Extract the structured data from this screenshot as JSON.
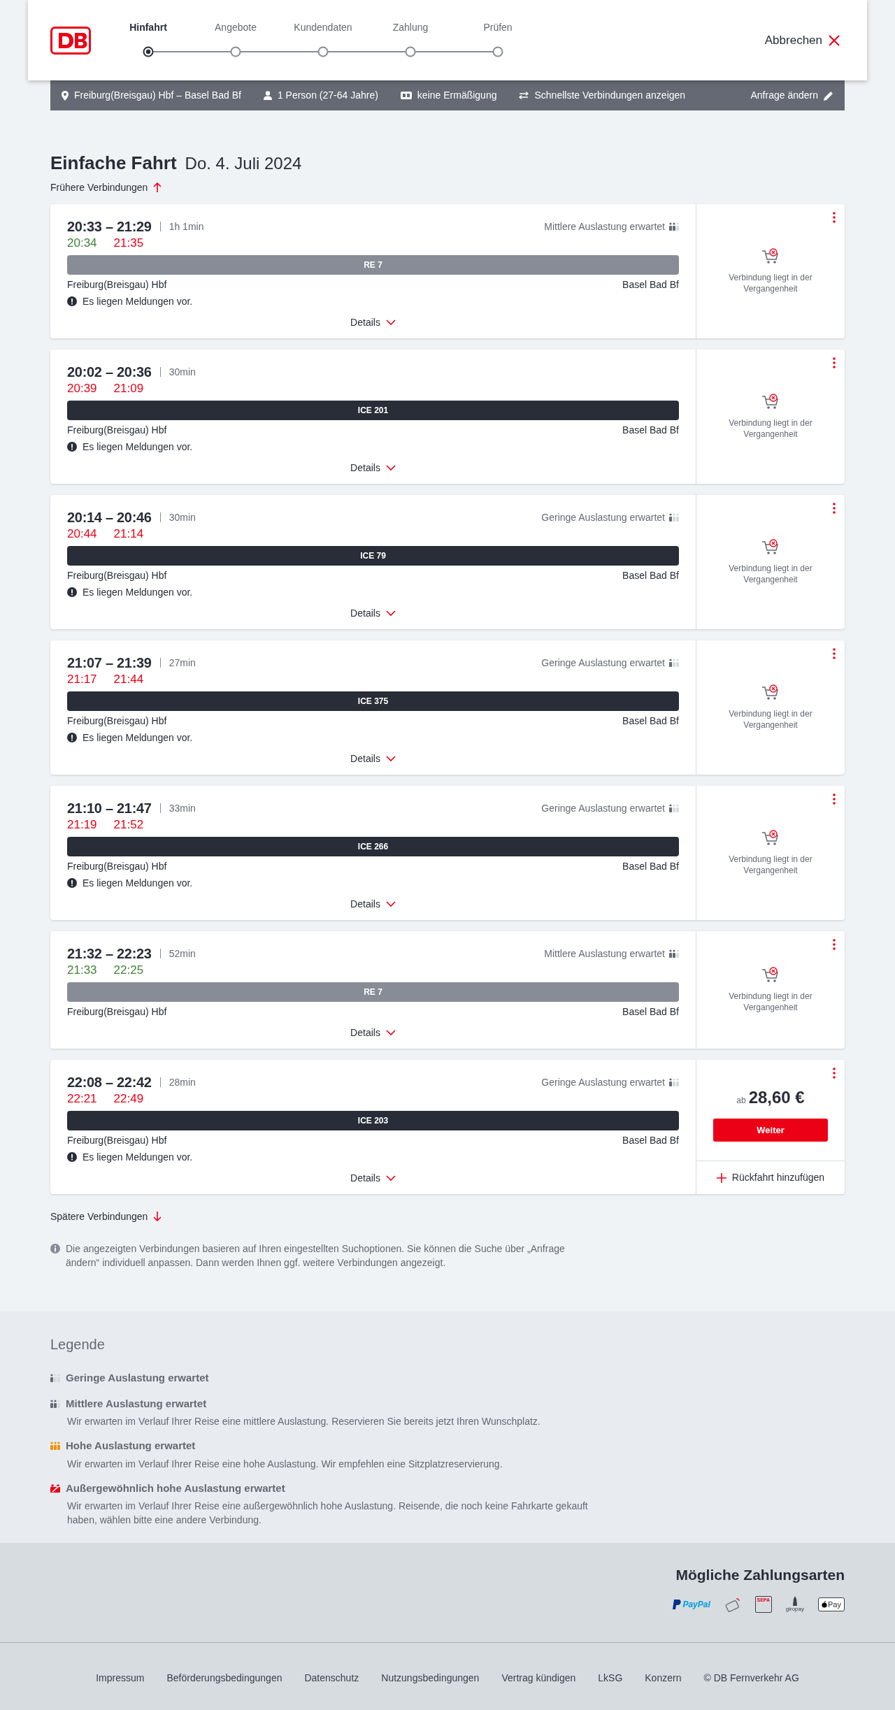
{
  "header": {
    "steps": [
      {
        "label": "Hinfahrt",
        "selected": true
      },
      {
        "label": "Angebote",
        "selected": false
      },
      {
        "label": "Kundendaten",
        "selected": false
      },
      {
        "label": "Zahlung",
        "selected": false
      },
      {
        "label": "Prüfen",
        "selected": false
      }
    ],
    "cancel": "Abbrechen"
  },
  "summary": {
    "items": [
      {
        "kind": "route",
        "text": "Freiburg(Breisgau) Hbf – Basel Bad Bf"
      },
      {
        "kind": "person",
        "text": "1 Person (27-64 Jahre)"
      },
      {
        "kind": "card",
        "text": "keine Ermäßigung"
      },
      {
        "kind": "option",
        "text": "Schnellste Verbindungen anzeigen"
      }
    ],
    "edit": "Anfrage ändern"
  },
  "title": "Einfache Fahrt",
  "date": "Do. 4. Juli 2024",
  "earlier": "Frühere Verbindungen",
  "connections": [
    {
      "times": "20:33 – 21:29",
      "duration": "1h 1min",
      "occupancy": {
        "kind": "medium",
        "text": "Mittlere Auslastung erwartet"
      },
      "actual": [
        {
          "time": "20:34",
          "delayed": false
        },
        {
          "time": "21:35",
          "delayed": true
        }
      ],
      "train": {
        "kind": "regional",
        "name": "RE 7"
      },
      "from": "Freiburg(Breisgau) Hbf",
      "to": "Basel Bad Bf",
      "notice": "Es liegen Meldungen vor.",
      "details": "Details",
      "offer": {
        "kind": "past",
        "text": "Verbindung liegt in der Vergangenheit"
      }
    },
    {
      "times": "20:02 – 20:36",
      "duration": "30min",
      "actual": [
        {
          "time": "20:39",
          "delayed": true
        },
        {
          "time": "21:09",
          "delayed": true
        }
      ],
      "train": {
        "kind": "ice",
        "name": "ICE 201"
      },
      "from": "Freiburg(Breisgau) Hbf",
      "to": "Basel Bad Bf",
      "notice": "Es liegen Meldungen vor.",
      "details": "Details",
      "offer": {
        "kind": "past",
        "text": "Verbindung liegt in der Vergangenheit"
      }
    },
    {
      "times": "20:14 – 20:46",
      "duration": "30min",
      "occupancy": {
        "kind": "low",
        "text": "Geringe Auslastung erwartet"
      },
      "actual": [
        {
          "time": "20:44",
          "delayed": true
        },
        {
          "time": "21:14",
          "delayed": true
        }
      ],
      "train": {
        "kind": "ice",
        "name": "ICE 79"
      },
      "from": "Freiburg(Breisgau) Hbf",
      "to": "Basel Bad Bf",
      "notice": "Es liegen Meldungen vor.",
      "details": "Details",
      "offer": {
        "kind": "past",
        "text": "Verbindung liegt in der Vergangenheit"
      }
    },
    {
      "times": "21:07 – 21:39",
      "duration": "27min",
      "occupancy": {
        "kind": "low",
        "text": "Geringe Auslastung erwartet"
      },
      "actual": [
        {
          "time": "21:17",
          "delayed": true
        },
        {
          "time": "21:44",
          "delayed": true
        }
      ],
      "train": {
        "kind": "ice",
        "name": "ICE 375"
      },
      "from": "Freiburg(Breisgau) Hbf",
      "to": "Basel Bad Bf",
      "notice": "Es liegen Meldungen vor.",
      "details": "Details",
      "offer": {
        "kind": "past",
        "text": "Verbindung liegt in der Vergangenheit"
      }
    },
    {
      "times": "21:10 – 21:47",
      "duration": "33min",
      "occupancy": {
        "kind": "low",
        "text": "Geringe Auslastung erwartet"
      },
      "actual": [
        {
          "time": "21:19",
          "delayed": true
        },
        {
          "time": "21:52",
          "delayed": true
        }
      ],
      "train": {
        "kind": "ice",
        "name": "ICE 266"
      },
      "from": "Freiburg(Breisgau) Hbf",
      "to": "Basel Bad Bf",
      "notice": "Es liegen Meldungen vor.",
      "details": "Details",
      "offer": {
        "kind": "past",
        "text": "Verbindung liegt in der Vergangenheit"
      }
    },
    {
      "times": "21:32 – 22:23",
      "duration": "52min",
      "occupancy": {
        "kind": "medium",
        "text": "Mittlere Auslastung erwartet"
      },
      "actual": [
        {
          "time": "21:33",
          "delayed": false
        },
        {
          "time": "22:25",
          "delayed": false
        }
      ],
      "train": {
        "kind": "regional",
        "name": "RE 7"
      },
      "from": "Freiburg(Breisgau) Hbf",
      "to": "Basel Bad Bf",
      "details": "Details",
      "offer": {
        "kind": "past",
        "text": "Verbindung liegt in der Vergangenheit"
      }
    },
    {
      "times": "22:08 – 22:42",
      "duration": "28min",
      "occupancy": {
        "kind": "low",
        "text": "Geringe Auslastung erwartet"
      },
      "actual": [
        {
          "time": "22:21",
          "delayed": true
        },
        {
          "time": "22:49",
          "delayed": true
        }
      ],
      "train": {
        "kind": "ice",
        "name": "ICE 203"
      },
      "from": "Freiburg(Breisgau) Hbf",
      "to": "Basel Bad Bf",
      "notice": "Es liegen Meldungen vor.",
      "details": "Details",
      "offer": {
        "kind": "price",
        "prefix": "ab",
        "price": "28,60 €",
        "button": "Weiter",
        "return": "Rückfahrt hinzufügen"
      }
    }
  ],
  "later": "Spätere Verbindungen",
  "info": "Die angezeigten Verbindungen basieren auf Ihren eingestellten Suchoptionen. Sie können die Suche über „Anfrage ändern“ individuell anpassen. Dann werden Ihnen ggf. weitere Verbindungen angezeigt.",
  "legend": {
    "title": "Legende",
    "items": [
      {
        "kind": "low",
        "title": "Geringe Auslastung erwartet"
      },
      {
        "kind": "medium",
        "title": "Mittlere Auslastung erwartet",
        "text": "Wir erwarten im Verlauf Ihrer Reise eine mittlere Auslastung. Reservieren Sie bereits jetzt Ihren Wunschplatz."
      },
      {
        "kind": "high",
        "title": "Hohe Auslastung erwartet",
        "text": "Wir erwarten im Verlauf Ihrer Reise eine hohe Auslastung. Wir empfehlen eine Sitzplatzreservierung."
      },
      {
        "kind": "exceptional",
        "title": "Außergewöhnlich hohe Auslastung erwartet",
        "text": "Wir erwarten im Verlauf Ihrer Reise eine außergewöhnlich hohe Auslastung. Reisende, die noch keine Fahrkarte gekauft haben, wählen bitte eine andere Verbindung."
      }
    ]
  },
  "payment": {
    "title": "Mögliche Zahlungsarten",
    "methods": [
      {
        "kind": "paypal",
        "label": "PayPal"
      },
      {
        "kind": "creditcard"
      },
      {
        "kind": "sepa",
        "label": "SEPA"
      },
      {
        "kind": "giropay",
        "label": "giropay"
      },
      {
        "kind": "applepay",
        "label": "Pay"
      }
    ]
  },
  "footer": [
    "Impressum",
    "Beförderungsbedingungen",
    "Datenschutz",
    "Nutzungsbedingungen",
    "Vertrag kündigen",
    "LkSG",
    "Konzern",
    "© DB Fernverkehr AG"
  ]
}
